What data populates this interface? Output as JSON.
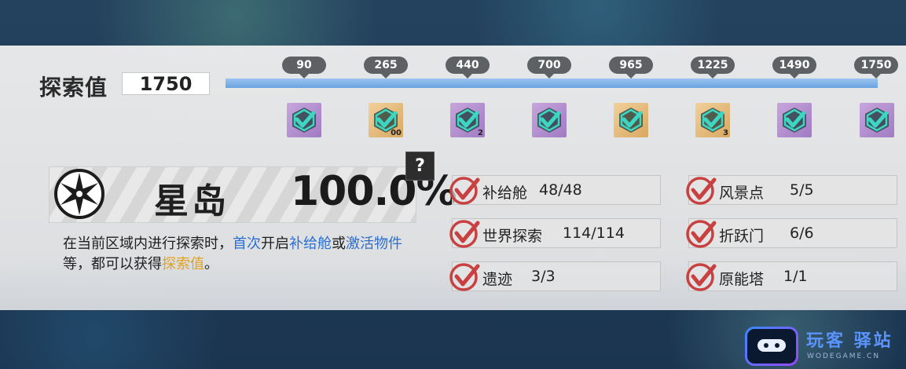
{
  "exploration": {
    "label": "探索值",
    "value": "1750",
    "progress": 1.0,
    "bar_color": "#7fb1e8",
    "milestones": [
      {
        "value": "90",
        "reward_bg": "purple",
        "count": ""
      },
      {
        "value": "265",
        "reward_bg": "gold",
        "count": "00"
      },
      {
        "value": "440",
        "reward_bg": "purple",
        "count": "2"
      },
      {
        "value": "700",
        "reward_bg": "purple",
        "count": ""
      },
      {
        "value": "965",
        "reward_bg": "gold",
        "count": ""
      },
      {
        "value": "1225",
        "reward_bg": "gold",
        "count": "3"
      },
      {
        "value": "1490",
        "reward_bg": "purple",
        "count": ""
      },
      {
        "value": "1750",
        "reward_bg": "purple",
        "count": ""
      }
    ]
  },
  "region": {
    "name": "星岛",
    "percent": "100.0%",
    "help": "?",
    "icon": "compass-star-icon"
  },
  "description": {
    "p1": "在当前区域内进行探索时，",
    "h1": "首次",
    "p2": "开启",
    "h2": "补给舱",
    "p3": "或",
    "h3": "激活物件",
    "p4": "等，都可以获得",
    "h4": "探索值",
    "p5": "。"
  },
  "stats": [
    {
      "name": "补给舱",
      "value": "48/48"
    },
    {
      "name": "风景点",
      "value": "5/5"
    },
    {
      "name": "世界探索",
      "value": "114/114"
    },
    {
      "name": "折跃门",
      "value": "6/6"
    },
    {
      "name": "遗迹",
      "value": "3/3"
    },
    {
      "name": "原能塔",
      "value": "1/1"
    }
  ],
  "colors": {
    "check_teal": "#3dd6c2",
    "check_red": "#c84040",
    "highlight_blue": "#2c6fd1",
    "highlight_orange": "#e3a222"
  },
  "watermark": {
    "title": "玩客 驿站",
    "sub": "WODEGAME.CN"
  }
}
